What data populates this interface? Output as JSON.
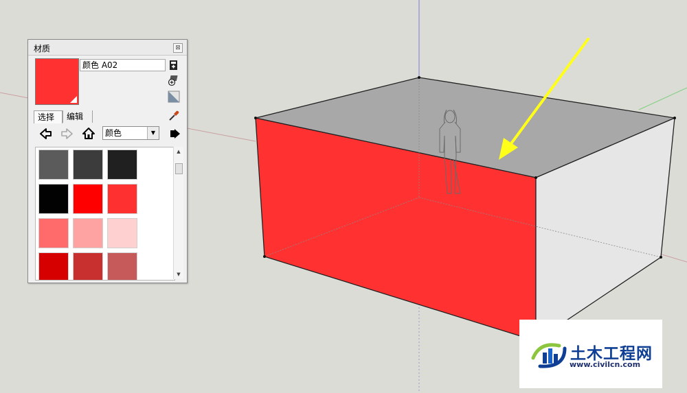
{
  "materials_panel": {
    "title": "材质",
    "close_glyph": "⊠",
    "material_name": "颜色 A02",
    "tabs": [
      "选择",
      "编辑"
    ],
    "library_selected": "颜色",
    "preview_color": "#ff3131",
    "swatches": [
      "#5b5b5b",
      "#3c3c3c",
      "#202020",
      "#020202",
      "#ff0000",
      "#ff3030",
      "#ff6b6b",
      "#ffa2a2",
      "#ffd0d0",
      "#d60000",
      "#c83030",
      "#c65a5a"
    ],
    "icons": {
      "back": "arrow-left-icon",
      "forward": "arrow-right-icon",
      "home": "home-icon",
      "details": "details-arrow-icon",
      "create": "create-material-icon",
      "sample_paint": "sample-paint-icon",
      "default_material": "default-material-icon",
      "eyedropper": "eyedropper-icon"
    }
  },
  "watermark": {
    "text_cn": "土木工程网",
    "url": "www.civilcn.com"
  },
  "scene": {
    "front_face_color": "#ff3131",
    "top_face_color": "#a8a8a8",
    "side_face_color": "#e6e6e6",
    "arrow_color": "#ffff1a",
    "background_color": "#dcdcd7"
  }
}
